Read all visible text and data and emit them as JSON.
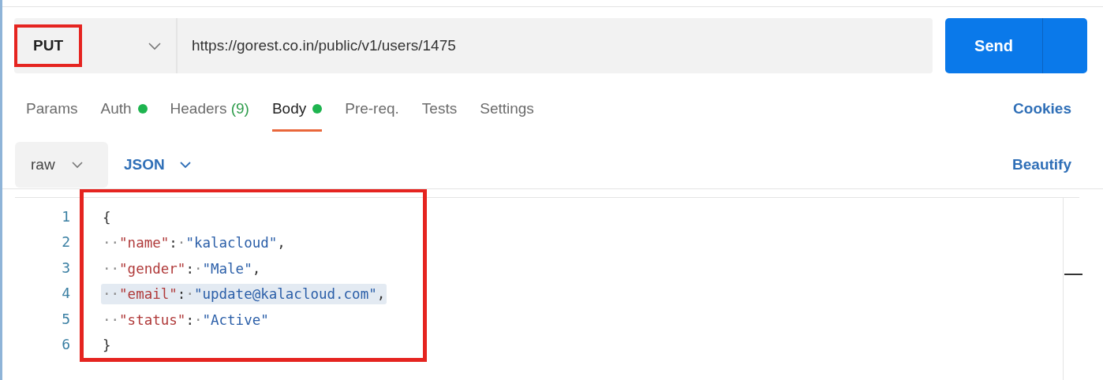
{
  "request": {
    "method": "PUT",
    "method_highlighted": true,
    "url": "https://gorest.co.in/public/v1/users/1475",
    "send": "Send"
  },
  "tabs": [
    {
      "label": "Params",
      "selected": false
    },
    {
      "label": "Auth",
      "selected": false,
      "dot": true
    },
    {
      "label": "Headers",
      "count": "(9)",
      "selected": false
    },
    {
      "label": "Body",
      "selected": true,
      "dot": true
    },
    {
      "label": "Pre-req.",
      "selected": false
    },
    {
      "label": "Tests",
      "selected": false
    },
    {
      "label": "Settings",
      "selected": false
    }
  ],
  "cookies": "Cookies",
  "body_options": {
    "mode": "raw",
    "format": "JSON",
    "beautify": "Beautify"
  },
  "editor": {
    "highlighted": true,
    "lines": [
      {
        "number": "1",
        "selected": false,
        "tokens": [
          {
            "kind": "punct",
            "text": "{"
          }
        ]
      },
      {
        "number": "2",
        "selected": false,
        "tokens": [
          {
            "kind": "ws",
            "text": "··"
          },
          {
            "kind": "key",
            "text": "\"name\""
          },
          {
            "kind": "punct",
            "text": ":"
          },
          {
            "kind": "ws",
            "text": "·"
          },
          {
            "kind": "string",
            "text": "\"kalacloud\""
          },
          {
            "kind": "punct",
            "text": ","
          }
        ]
      },
      {
        "number": "3",
        "selected": false,
        "tokens": [
          {
            "kind": "ws",
            "text": "··"
          },
          {
            "kind": "key",
            "text": "\"gender\""
          },
          {
            "kind": "punct",
            "text": ":"
          },
          {
            "kind": "ws",
            "text": "·"
          },
          {
            "kind": "string",
            "text": "\"Male\""
          },
          {
            "kind": "punct",
            "text": ","
          }
        ]
      },
      {
        "number": "4",
        "selected": true,
        "tokens": [
          {
            "kind": "ws",
            "text": "··"
          },
          {
            "kind": "key",
            "text": "\"email\""
          },
          {
            "kind": "punct",
            "text": ":"
          },
          {
            "kind": "ws",
            "text": "·"
          },
          {
            "kind": "string",
            "text": "\"update@kalacloud.com\""
          },
          {
            "kind": "punct",
            "text": ","
          }
        ]
      },
      {
        "number": "5",
        "selected": false,
        "tokens": [
          {
            "kind": "ws",
            "text": "··"
          },
          {
            "kind": "key",
            "text": "\"status\""
          },
          {
            "kind": "punct",
            "text": ":"
          },
          {
            "kind": "ws",
            "text": "·"
          },
          {
            "kind": "string",
            "text": "\"Active\""
          }
        ]
      },
      {
        "number": "6",
        "selected": false,
        "tokens": [
          {
            "kind": "punct",
            "text": "}"
          }
        ]
      }
    ]
  }
}
